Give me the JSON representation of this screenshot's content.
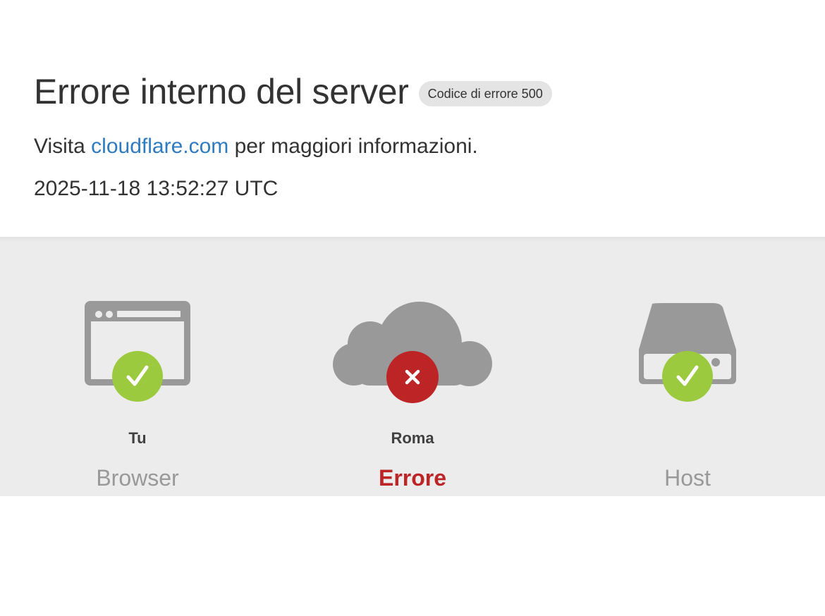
{
  "header": {
    "title": "Errore interno del server",
    "error_badge": "Codice di errore 500",
    "visit_prefix": "Visita",
    "visit_link": "cloudflare.com",
    "visit_suffix": "per maggiori informazioni.",
    "timestamp": "2025-11-18 13:52:27 UTC"
  },
  "colors": {
    "link": "#2f7bbf",
    "ok": "#9bca3e",
    "error": "#bd2426",
    "icon_gray": "#999999"
  },
  "nodes": [
    {
      "location": "Tu",
      "label": "Browser",
      "icon": "browser-window-icon",
      "status": "ok",
      "status_icon": "checkmark-icon"
    },
    {
      "location": "Roma",
      "label": "Errore",
      "icon": "cloud-icon",
      "status": "error",
      "status_icon": "x-mark-icon"
    },
    {
      "location": "",
      "label": "Host",
      "icon": "server-drive-icon",
      "status": "ok",
      "status_icon": "checkmark-icon"
    }
  ]
}
